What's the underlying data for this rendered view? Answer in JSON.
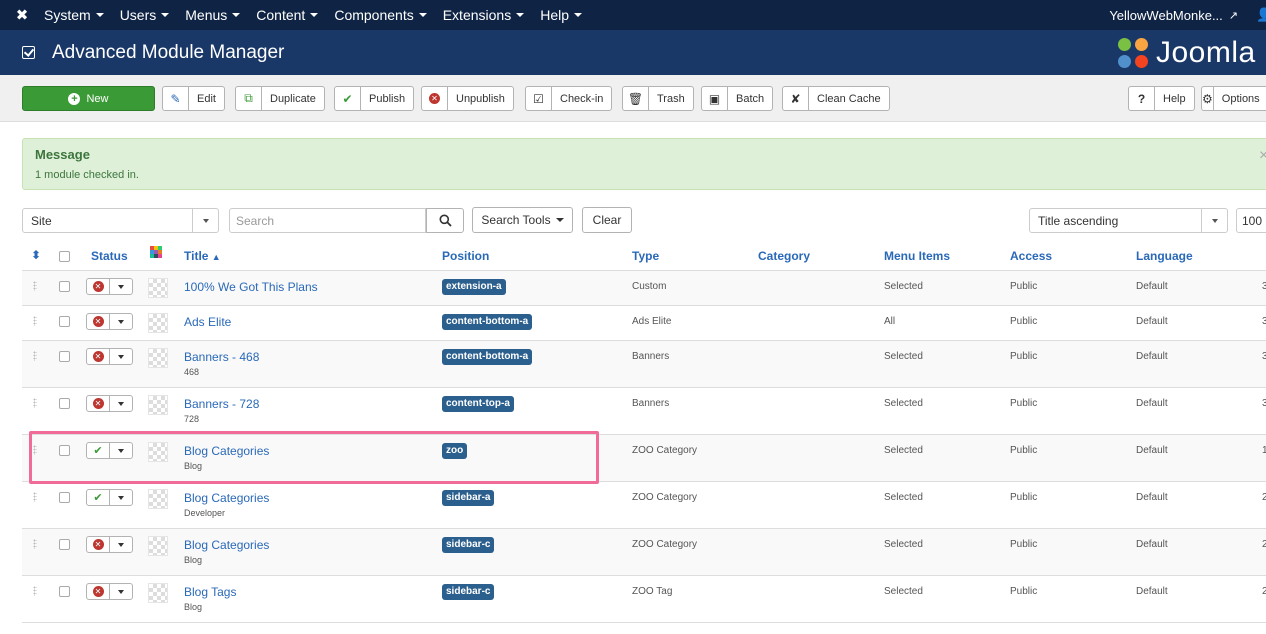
{
  "navbar": {
    "menu": [
      {
        "label": "System"
      },
      {
        "label": "Users"
      },
      {
        "label": "Menus"
      },
      {
        "label": "Content"
      },
      {
        "label": "Components"
      },
      {
        "label": "Extensions"
      },
      {
        "label": "Help"
      }
    ],
    "site_link": "YellowWebMonke..."
  },
  "header": {
    "title": "Advanced Module Manager",
    "brand": "Joomla"
  },
  "toolbar": {
    "new": "New",
    "edit": "Edit",
    "duplicate": "Duplicate",
    "publish": "Publish",
    "unpublish": "Unpublish",
    "checkin": "Check-in",
    "trash": "Trash",
    "batch": "Batch",
    "clean_cache": "Clean Cache",
    "help": "Help",
    "options": "Options"
  },
  "message": {
    "heading": "Message",
    "text": "1 module checked in."
  },
  "filters": {
    "client": "Site",
    "search_placeholder": "Search",
    "search_tools": "Search Tools",
    "clear": "Clear",
    "ordering": "Title ascending",
    "limit": "100"
  },
  "table": {
    "headers": {
      "status": "Status",
      "title": "Title",
      "position": "Position",
      "type": "Type",
      "category": "Category",
      "menu_items": "Menu Items",
      "access": "Access",
      "language": "Language"
    },
    "rows": [
      {
        "status": "unpublished",
        "title": "100% We Got This Plans",
        "note": "",
        "position": "extension-a",
        "type": "Custom",
        "category": "",
        "menu_items": "Selected",
        "access": "Public",
        "language": "Default",
        "pages": "3"
      },
      {
        "status": "unpublished",
        "title": "Ads Elite",
        "note": "",
        "position": "content-bottom-a",
        "type": "Ads Elite",
        "category": "",
        "menu_items": "All",
        "access": "Public",
        "language": "Default",
        "pages": "3"
      },
      {
        "status": "unpublished",
        "title": "Banners - 468",
        "note": "468",
        "position": "content-bottom-a",
        "type": "Banners",
        "category": "",
        "menu_items": "Selected",
        "access": "Public",
        "language": "Default",
        "pages": "3"
      },
      {
        "status": "unpublished",
        "title": "Banners - 728",
        "note": "728",
        "position": "content-top-a",
        "type": "Banners",
        "category": "",
        "menu_items": "Selected",
        "access": "Public",
        "language": "Default",
        "pages": "3"
      },
      {
        "status": "published",
        "title": "Blog Categories",
        "note": "Blog",
        "position": "zoo",
        "type": "ZOO Category",
        "category": "",
        "menu_items": "Selected",
        "access": "Public",
        "language": "Default",
        "pages": "1"
      },
      {
        "status": "published",
        "title": "Blog Categories",
        "note": "Developer",
        "position": "sidebar-a",
        "type": "ZOO Category",
        "category": "",
        "menu_items": "Selected",
        "access": "Public",
        "language": "Default",
        "pages": "2"
      },
      {
        "status": "unpublished",
        "title": "Blog Categories",
        "note": "Blog",
        "position": "sidebar-c",
        "type": "ZOO Category",
        "category": "",
        "menu_items": "Selected",
        "access": "Public",
        "language": "Default",
        "pages": "2"
      },
      {
        "status": "unpublished",
        "title": "Blog Tags",
        "note": "Blog",
        "position": "sidebar-c",
        "type": "ZOO Tag",
        "category": "",
        "menu_items": "Selected",
        "access": "Public",
        "language": "Default",
        "pages": "2"
      }
    ]
  },
  "colors": {
    "navbar": "#0f2444",
    "subhead": "#1a3867",
    "new_button": "#3a9a36",
    "link": "#2a69b8",
    "position_badge": "#2b5f8e",
    "highlight": "#f06b98"
  }
}
